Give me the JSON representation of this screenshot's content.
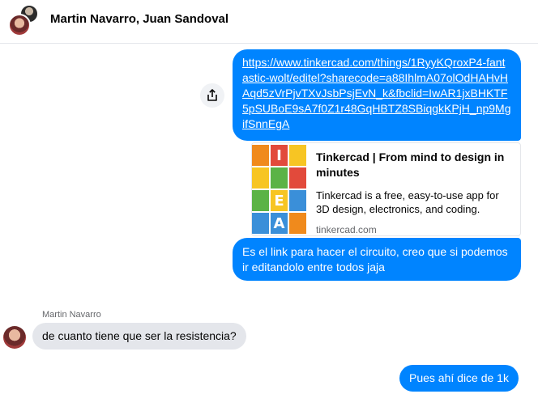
{
  "header": {
    "title": "Martin Navarro, Juan Sandoval",
    "icons": [
      "group-avatar-icon"
    ]
  },
  "messages": {
    "link": {
      "url_text": "https://www.tinkercad.com/things/1RyyKQroxP4-fantastic-wolt/editel?sharecode=a88IhlmA07olOdHAHvHAqd5zVrPjvTXvJsbPsjEvN_k&fbclid=IwAR1jxBHKTF5pSUBoE9sA7f0Z1r48GqHBTZ8SBiqgkKPjH_np9MgifSnnEgA"
    },
    "preview": {
      "title": "Tinkercad | From mind to design in minutes",
      "description": "Tinkercad is a free, easy-to-use app for 3D design, electronics, and coding.",
      "domain": "tinkercad.com",
      "logo_letters": [
        "I",
        "E",
        "A"
      ]
    },
    "outgoing_1": "Es el link para hacer el circuito, creo que si podemos ir editandolo entre todos jaja",
    "incoming_sender": "Martin Navarro",
    "incoming_1": "de cuanto tiene que ser la resistencia?",
    "outgoing_2": "Pues ahí dice de 1k"
  },
  "colors": {
    "outgoing_bubble": "#0084ff",
    "incoming_bubble": "#e4e6eb",
    "tile_orange": "#f08a1c",
    "tile_red": "#e24a3b",
    "tile_yellow": "#f7c523",
    "tile_green": "#5bb346",
    "tile_blue": "#3a8fd9"
  }
}
